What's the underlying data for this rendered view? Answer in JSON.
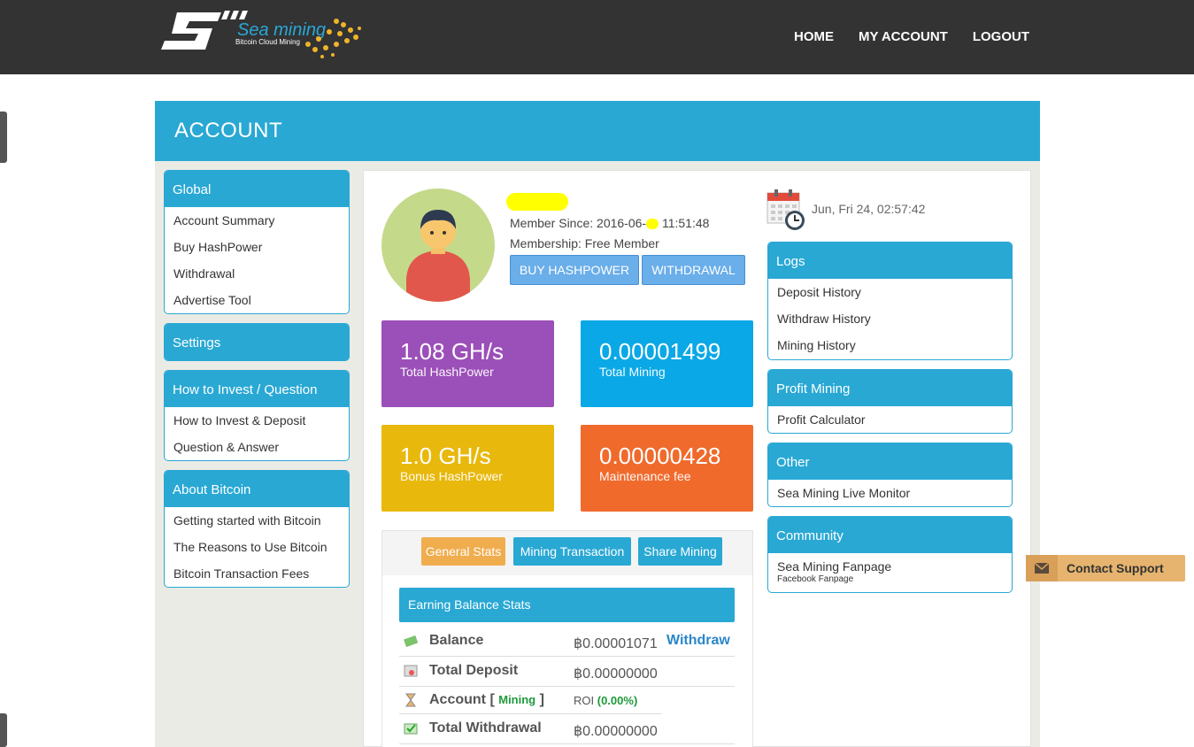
{
  "header": {
    "logo_text": "Sea mining",
    "logo_tagline": "Bitcoin Cloud Mining",
    "nav": [
      "HOME",
      "MY ACCOUNT",
      "LOGOUT"
    ]
  },
  "banner": {
    "title": "ACCOUNT"
  },
  "sidebar": {
    "groups": [
      {
        "title": "Global",
        "items": [
          "Account Summary",
          "Buy HashPower",
          "Withdrawal",
          "Advertise Tool"
        ]
      },
      {
        "title": "Settings",
        "items": []
      },
      {
        "title": "How to Invest / Question",
        "items": [
          "How to Invest & Deposit",
          "Question & Answer"
        ]
      },
      {
        "title": "About Bitcoin",
        "items": [
          "Getting started with Bitcoin",
          "The Reasons to Use Bitcoin",
          "Bitcoin Transaction Fees"
        ]
      }
    ]
  },
  "profile": {
    "member_since": "Member Since: 2016-06-",
    "member_since_time": "11:51:48",
    "membership": "Membership: Free Member",
    "buy_button": "BUY HASHPOWER",
    "withdraw_button": "WITHDRAWAL"
  },
  "stats": [
    {
      "value": "1.08 GH/s",
      "label": "Total HashPower",
      "color": "#9b4fb8"
    },
    {
      "value": "0.00001499",
      "label": "Total Mining",
      "color": "#0aa8e6"
    },
    {
      "value": "1.0 GH/s",
      "label": "Bonus HashPower",
      "color": "#e8b80c"
    },
    {
      "value": "0.00000428",
      "label": "Maintenance fee",
      "color": "#f06a2c"
    }
  ],
  "tabs": [
    "General Stats",
    "Mining Transaction",
    "Share Mining"
  ],
  "earning": {
    "title": "Earning Balance Stats",
    "balance_label": "Balance",
    "balance_value": "฿0.00001071",
    "withdraw_link": "Withdraw",
    "deposit_label": "Total Deposit",
    "deposit_value": "฿0.00000000",
    "account_label": "Account",
    "account_status": "Mining",
    "roi_label": "ROI",
    "roi_value": "(0.00%)",
    "withdrawal_label": "Total Withdrawal",
    "withdrawal_value": "฿0.00000000"
  },
  "clock": {
    "text": "Jun, Fri 24, 02:57:42"
  },
  "right_panels": [
    {
      "title": "Logs",
      "items": [
        "Deposit History",
        "Withdraw History",
        "Mining History"
      ]
    },
    {
      "title": "Profit Mining",
      "items": [
        "Profit Calculator"
      ]
    },
    {
      "title": "Other",
      "items": [
        "Sea Mining Live Monitor"
      ]
    },
    {
      "title": "Community",
      "items": [
        "Sea Mining Fanpage"
      ],
      "sub": "Facebook Fanpage"
    }
  ],
  "support": {
    "label": "Contact Support"
  }
}
